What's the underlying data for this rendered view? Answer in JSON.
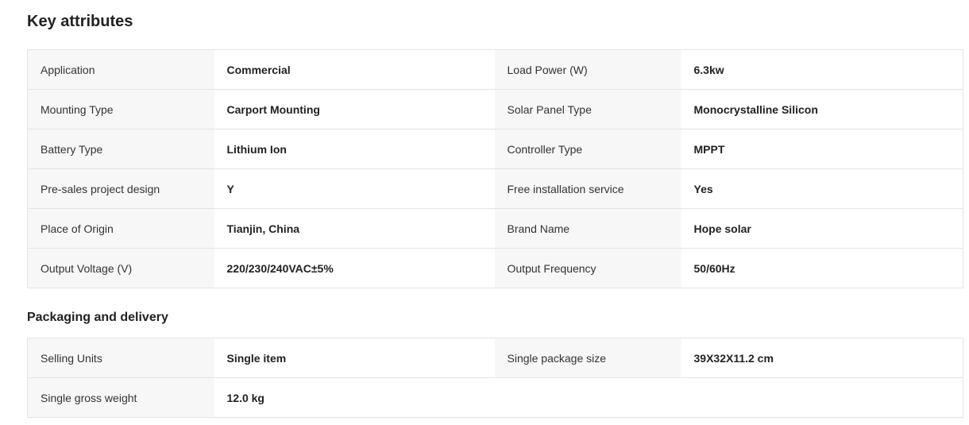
{
  "key_attributes": {
    "title": "Key attributes",
    "rows": [
      [
        {
          "label": "Application",
          "value": "Commercial"
        },
        {
          "label": "Load Power (W)",
          "value": "6.3kw"
        }
      ],
      [
        {
          "label": "Mounting Type",
          "value": "Carport Mounting"
        },
        {
          "label": "Solar Panel Type",
          "value": "Monocrystalline Silicon"
        }
      ],
      [
        {
          "label": "Battery Type",
          "value": "Lithium Ion"
        },
        {
          "label": "Controller Type",
          "value": "MPPT"
        }
      ],
      [
        {
          "label": "Pre-sales project design",
          "value": "Y"
        },
        {
          "label": "Free installation service",
          "value": "Yes"
        }
      ],
      [
        {
          "label": "Place of Origin",
          "value": "Tianjin, China"
        },
        {
          "label": "Brand Name",
          "value": "Hope solar"
        }
      ],
      [
        {
          "label": "Output Voltage (V)",
          "value": "220/230/240VAC±5%"
        },
        {
          "label": "Output Frequency",
          "value": "50/60Hz"
        }
      ]
    ]
  },
  "packaging": {
    "title": "Packaging and delivery",
    "rows": [
      [
        {
          "label": "Selling Units",
          "value": "Single item"
        },
        {
          "label": "Single package size",
          "value": "39X32X11.2 cm"
        }
      ],
      [
        {
          "label": "Single gross weight",
          "value": "12.0 kg"
        },
        {
          "label": "",
          "value": ""
        }
      ]
    ]
  }
}
